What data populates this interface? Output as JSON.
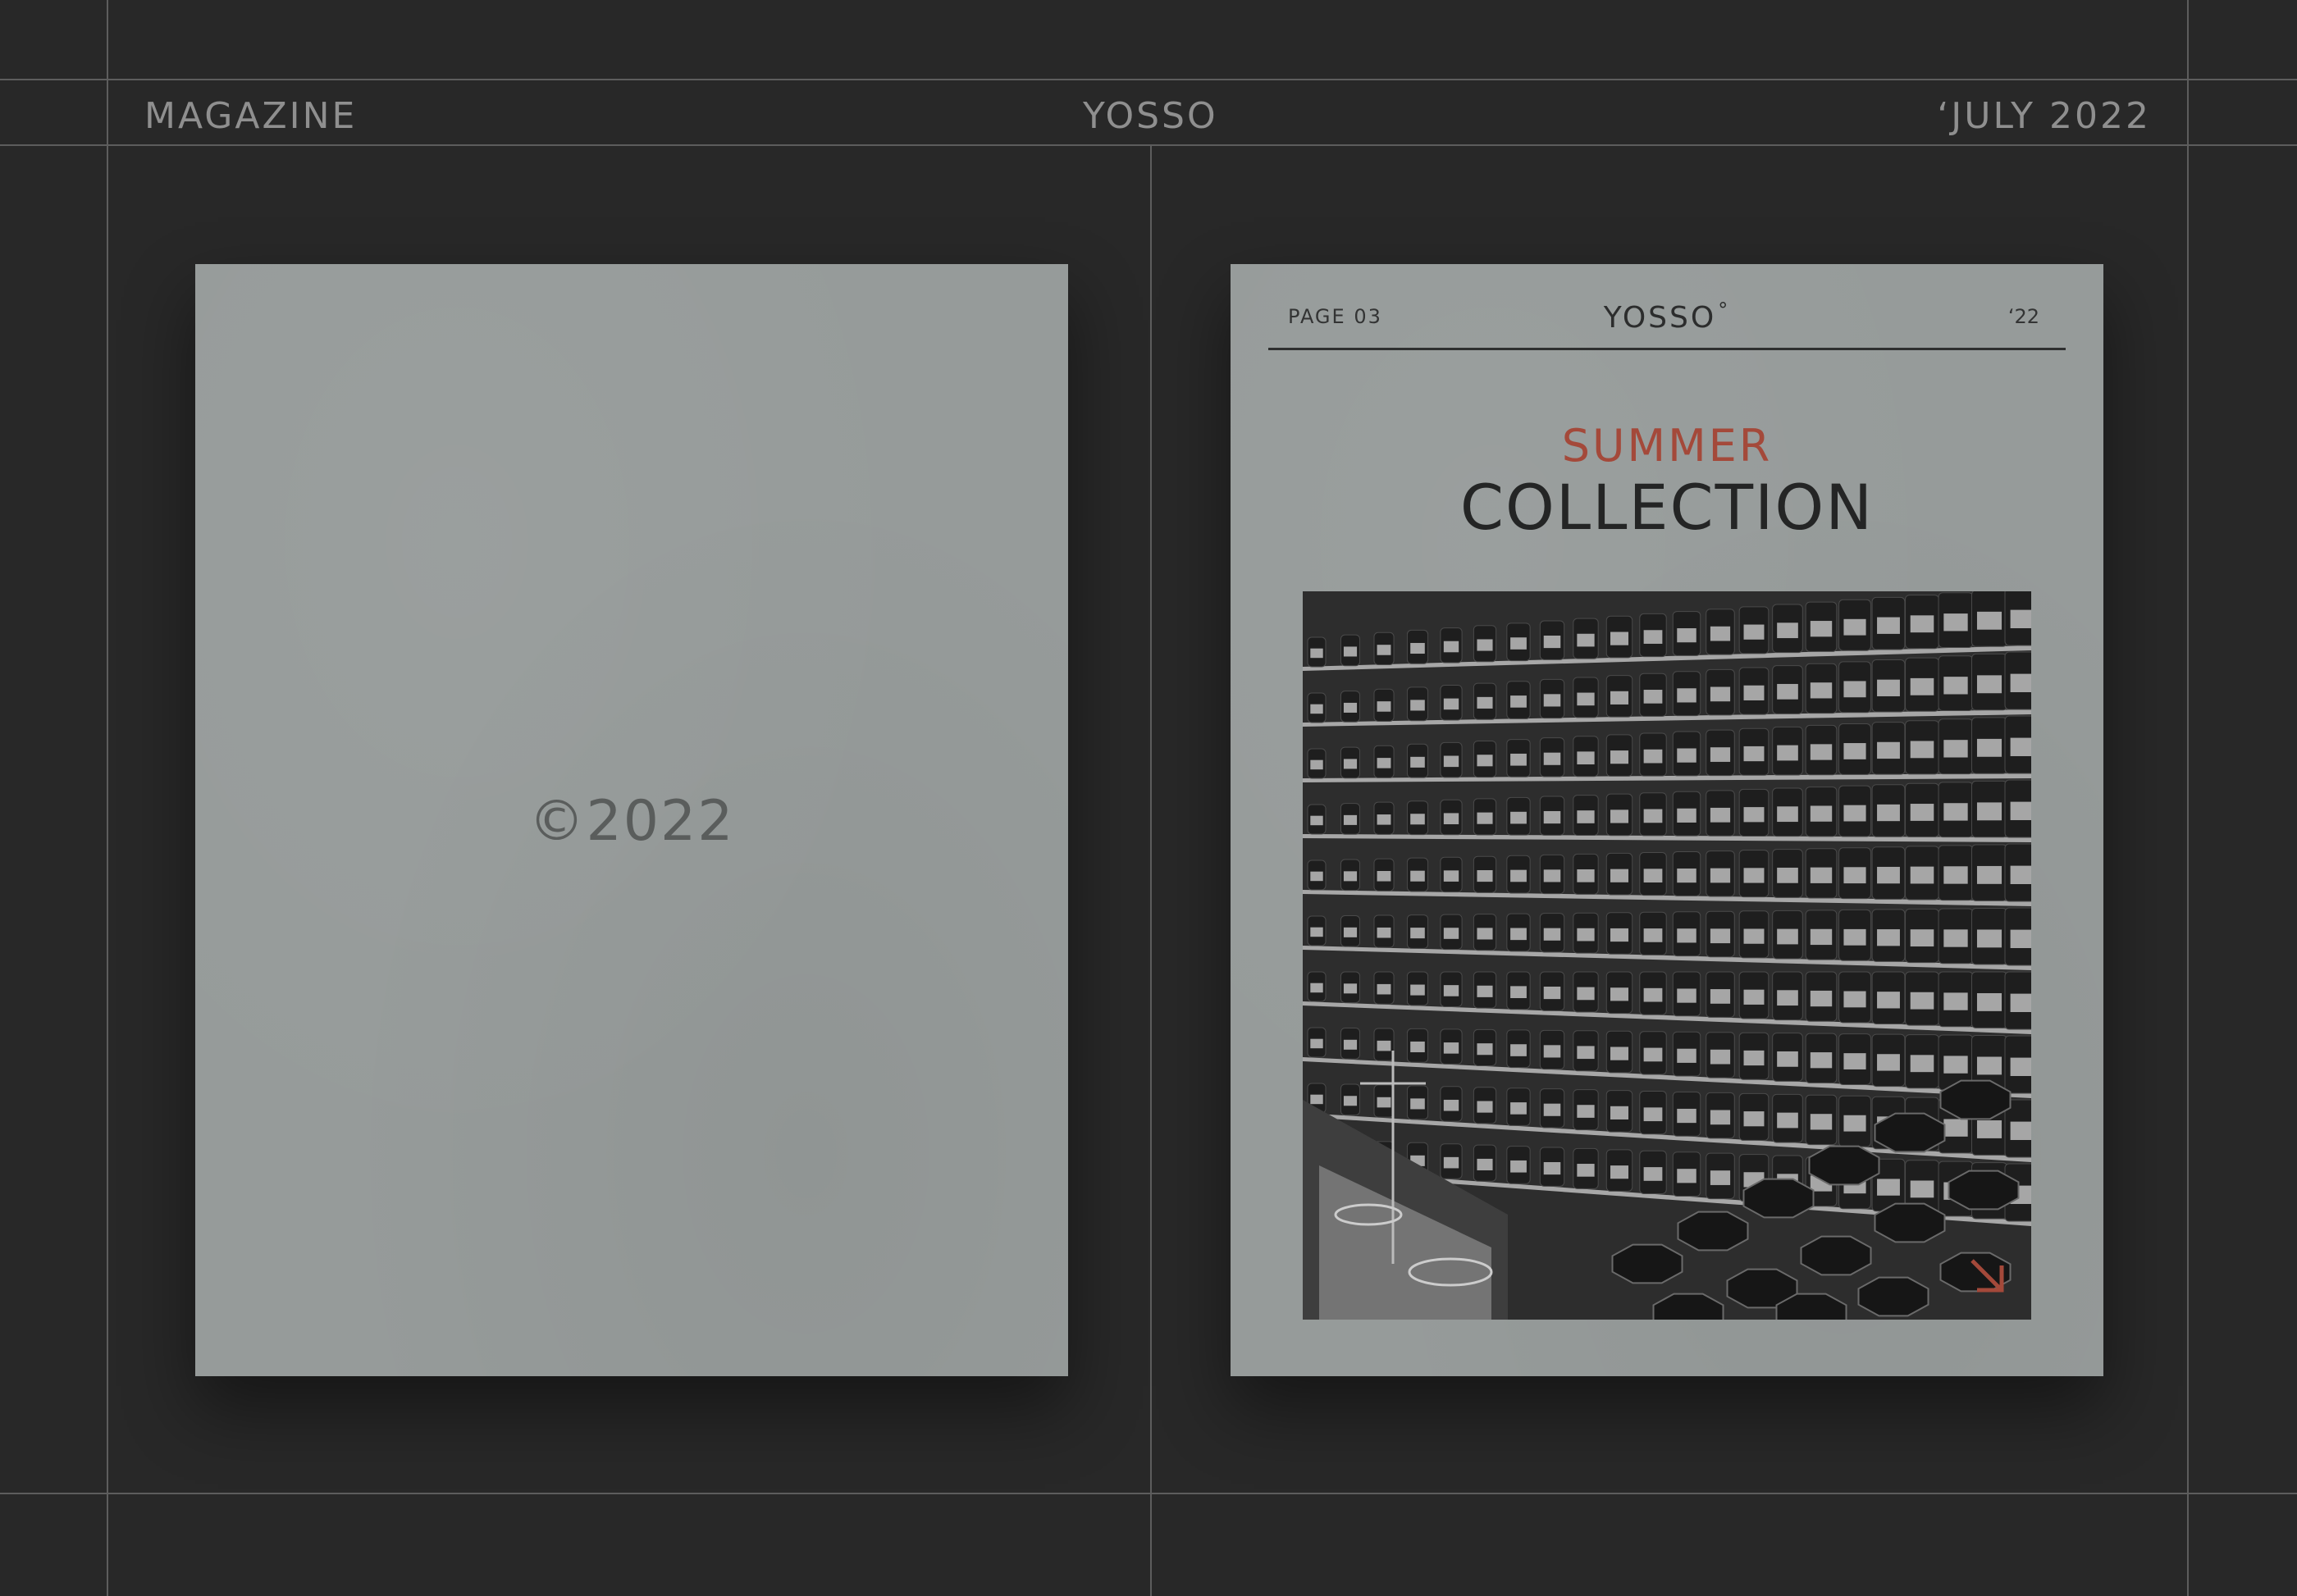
{
  "header": {
    "left_label": "MAGAZINE",
    "center_label": "YOSSO",
    "right_label": "ʻJULY 2022"
  },
  "left_page": {
    "copyright": "©2022"
  },
  "right_page": {
    "page_number": "PAGE 03",
    "brand": "YOSSO",
    "brand_mark": "°",
    "year": "ʻ22",
    "title_top": "SUMMER",
    "title_main": "COLLECTION",
    "photo_subject": "apothecary-shelves-photo",
    "arrow_icon": "arrow-down-right-icon"
  },
  "colors": {
    "background": "#282828",
    "guide": "#5d5d5d",
    "paper": "#969b9a",
    "accent": "#a4493a",
    "ink": "#242525"
  }
}
